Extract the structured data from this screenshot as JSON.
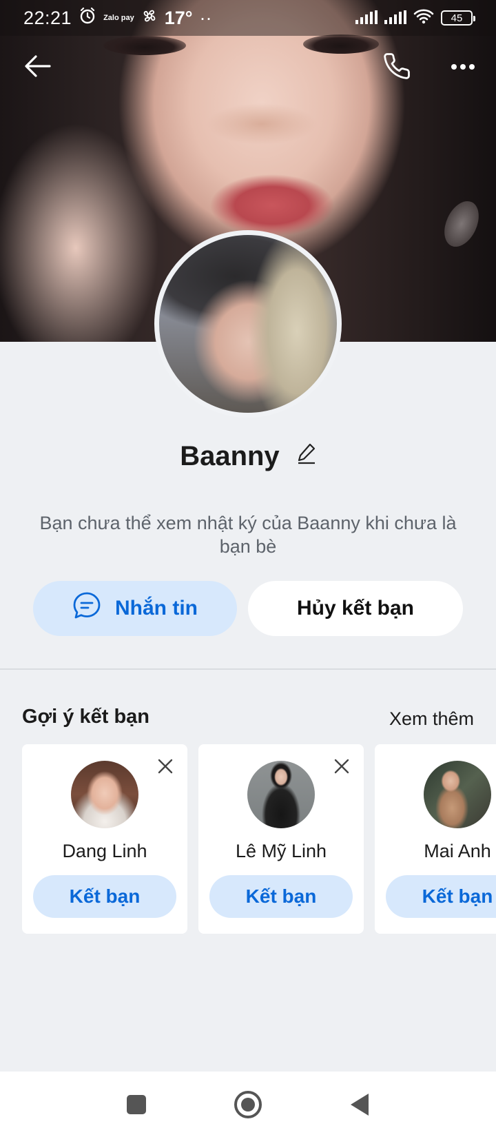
{
  "status_bar": {
    "time": "22:21",
    "zalopay_label": "Zalo pay",
    "temperature": "17°",
    "extra_dots": "··",
    "battery": "45"
  },
  "nav": {
    "back_icon": "arrow-left-icon",
    "call_icon": "phone-icon",
    "more_icon": "more-horizontal-icon"
  },
  "profile": {
    "name": "Baanny",
    "notice": "Bạn chưa thể xem nhật ký của Baanny khi chưa là bạn bè"
  },
  "actions": {
    "message_label": "Nhắn tin",
    "unfriend_label": "Hủy kết bạn"
  },
  "suggestions": {
    "title": "Gợi ý kết bạn",
    "see_more": "Xem thêm",
    "add_label": "Kết bạn",
    "items": [
      {
        "name": "Dang Linh"
      },
      {
        "name": "Lê Mỹ Linh"
      },
      {
        "name": "Mai Anh"
      }
    ]
  },
  "colors": {
    "accent": "#0a68d8",
    "accent_soft": "#d7e8fc",
    "background": "#eef0f3"
  }
}
